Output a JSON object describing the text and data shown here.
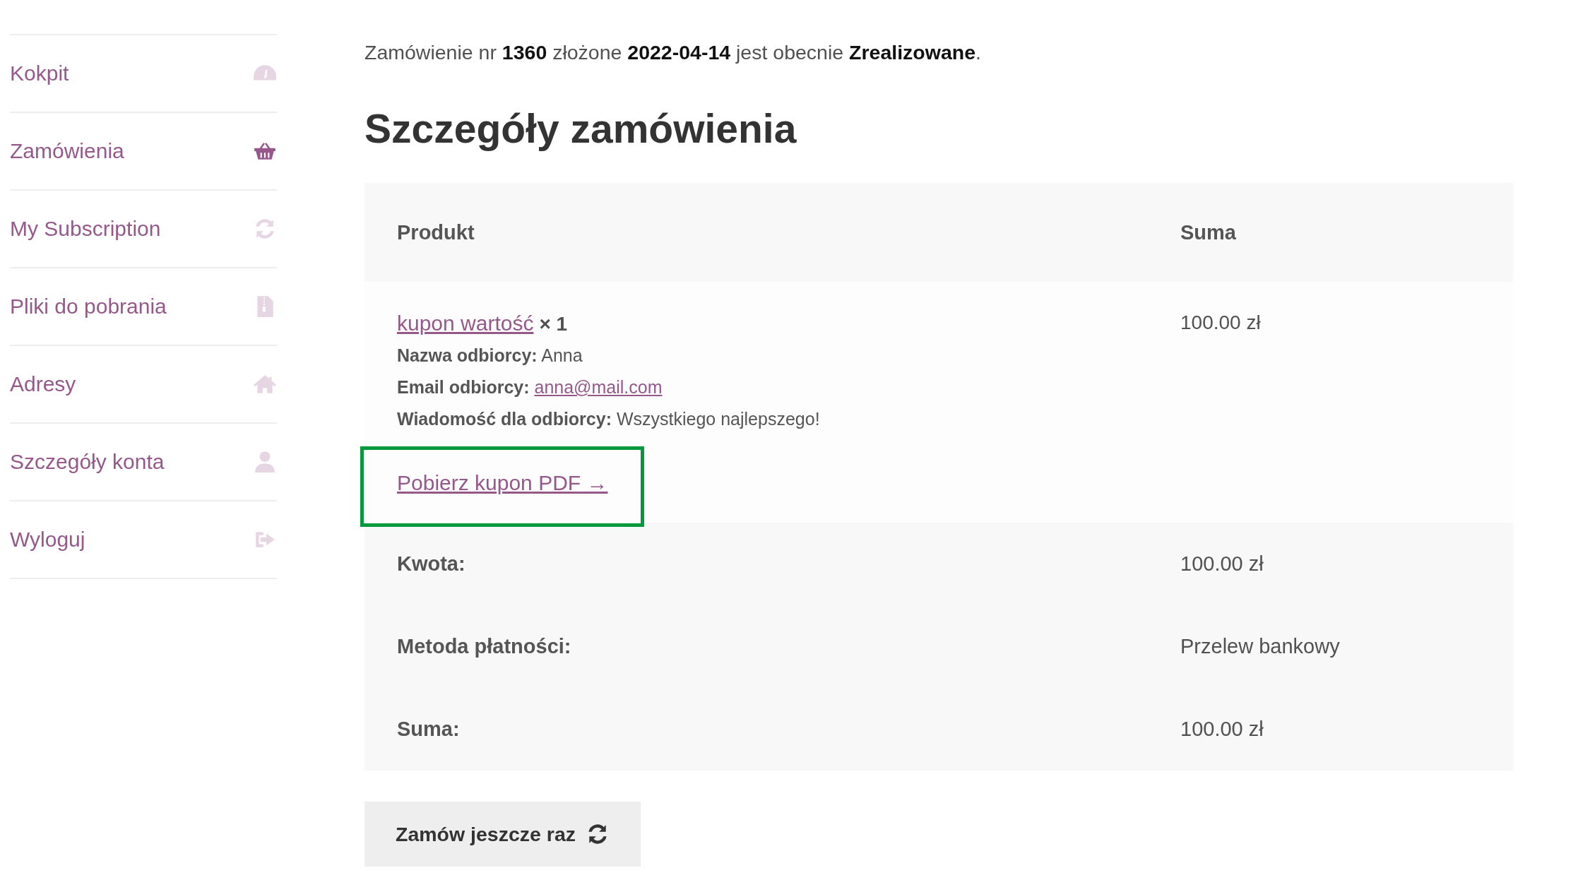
{
  "sidebar": {
    "items": [
      {
        "label": "Kokpit",
        "selected": false
      },
      {
        "label": "Zamówienia",
        "selected": true
      },
      {
        "label": "My Subscription",
        "selected": false
      },
      {
        "label": "Pliki do pobrania",
        "selected": false
      },
      {
        "label": "Adresy",
        "selected": false
      },
      {
        "label": "Szczegóły konta",
        "selected": false
      },
      {
        "label": "Wyloguj",
        "selected": false
      }
    ]
  },
  "order_notice": "Zamówienie nr **1360** złożone **2022-04-14** jest obecnie **Zrealizowane**.",
  "heading": "Szczegóły zamówienia",
  "table": {
    "columns": [
      "Produkt",
      "Suma"
    ],
    "product": {
      "name": "kupon wartość",
      "quantity": "× 1",
      "total": "100.00 zł",
      "meta": [
        {
          "label": "Nazwa odbiorcy:",
          "value": "Anna",
          "kind": "text"
        },
        {
          "label": "Email odbiorcy:",
          "value": "anna@mail.com",
          "kind": "link"
        },
        {
          "label": "Wiadomość dla odbiorcy:",
          "value": "Wszystkiego najlepszego!",
          "kind": "text"
        }
      ],
      "download_link": {
        "label": "Pobierz kupon PDF →",
        "highlighted": true
      }
    },
    "totals": [
      {
        "label": "Kwota:",
        "value": "100.00 zł"
      },
      {
        "label": "Metoda płatności:",
        "value": "Przelew bankowy"
      },
      {
        "label": "Suma:",
        "value": "100.00 zł"
      }
    ]
  },
  "order_again_button": {
    "label": "Zamów jeszcze raz"
  }
}
